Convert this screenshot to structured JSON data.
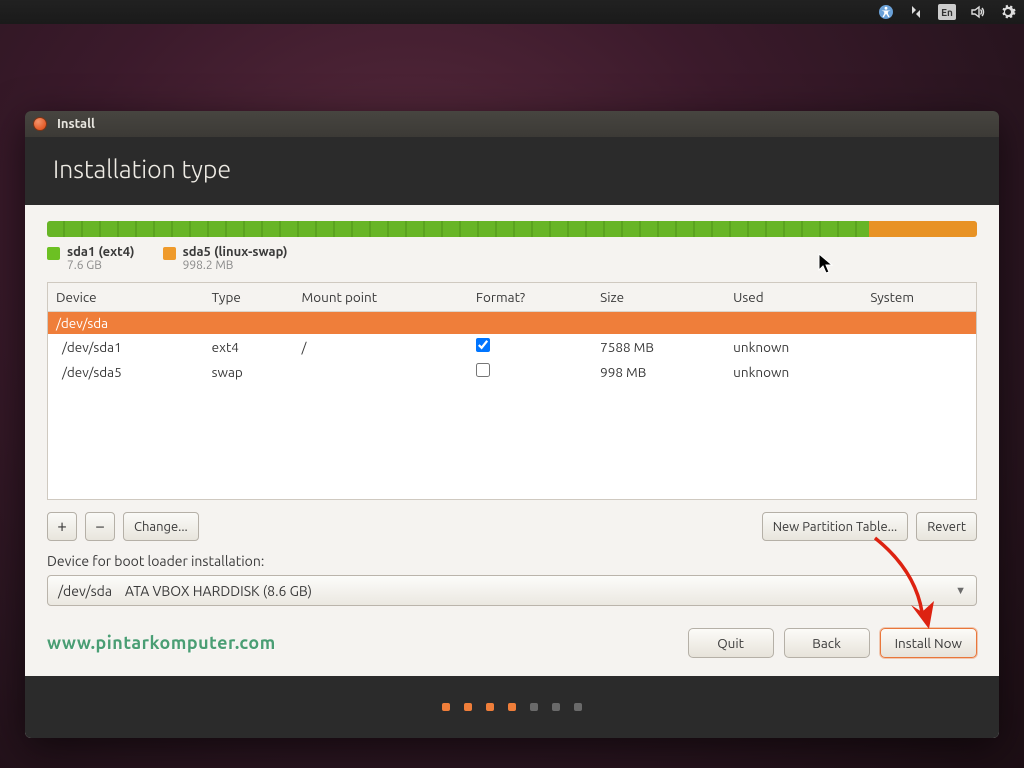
{
  "menubar": {
    "lang": "En"
  },
  "window": {
    "title": "Install",
    "heading": "Installation type"
  },
  "partitions": {
    "bar": [
      {
        "class": "ext4",
        "pct": 88.4
      },
      {
        "class": "swap",
        "pct": 11.6
      }
    ],
    "legend": [
      {
        "swatch": "green",
        "label": "sda1 (ext4)",
        "size": "7.6 GB"
      },
      {
        "swatch": "orange",
        "label": "sda5 (linux-swap)",
        "size": "998.2 MB"
      }
    ]
  },
  "table": {
    "cols": {
      "device": "Device",
      "type": "Type",
      "mount": "Mount point",
      "format": "Format?",
      "size": "Size",
      "used": "Used",
      "system": "System"
    },
    "disk": "/dev/sda",
    "rows": [
      {
        "device": "/dev/sda1",
        "type": "ext4",
        "mount": "/",
        "format": true,
        "size": "7588 MB",
        "used": "unknown",
        "system": ""
      },
      {
        "device": "/dev/sda5",
        "type": "swap",
        "mount": "",
        "format": false,
        "size": "998 MB",
        "used": "unknown",
        "system": ""
      }
    ]
  },
  "toolbar": {
    "add": "+",
    "remove": "−",
    "change": "Change...",
    "newtable": "New Partition Table...",
    "revert": "Revert"
  },
  "boot": {
    "label": "Device for boot loader installation:",
    "value": "/dev/sda    ATA VBOX HARDDISK (8.6 GB)"
  },
  "actions": {
    "watermark": "www.pintarkomputer.com",
    "quit": "Quit",
    "back": "Back",
    "install": "Install Now"
  },
  "dots": {
    "total": 7,
    "active": 4
  }
}
